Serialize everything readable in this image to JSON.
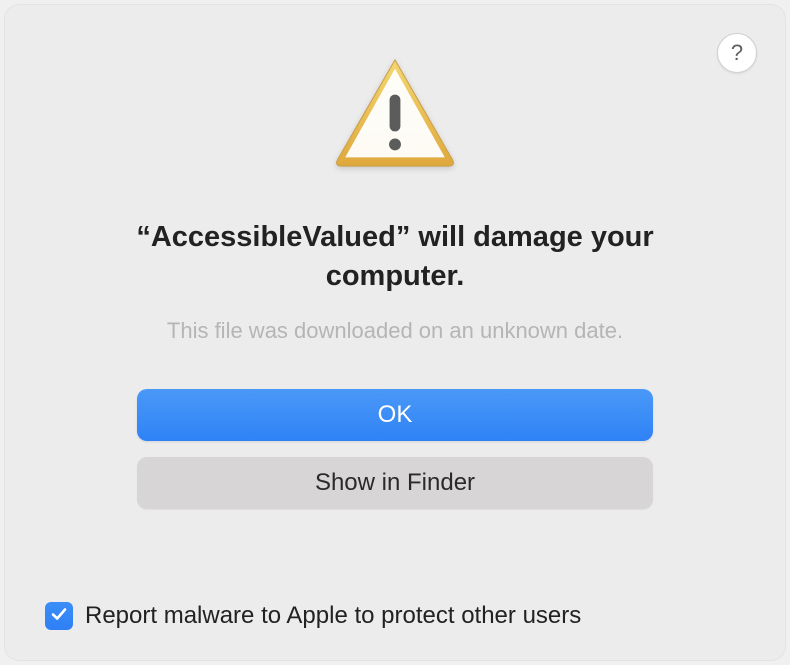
{
  "dialog": {
    "title": "“AccessibleValued” will damage your computer.",
    "subtitle": "This file was downloaded on an unknown date.",
    "help_label": "?",
    "buttons": {
      "ok": "OK",
      "show_in_finder": "Show in Finder"
    },
    "checkbox": {
      "label": "Report malware to Apple to protect other users",
      "checked": true
    },
    "icons": {
      "warning": "warning-triangle",
      "help": "question-mark",
      "checkmark": "checkmark"
    }
  }
}
